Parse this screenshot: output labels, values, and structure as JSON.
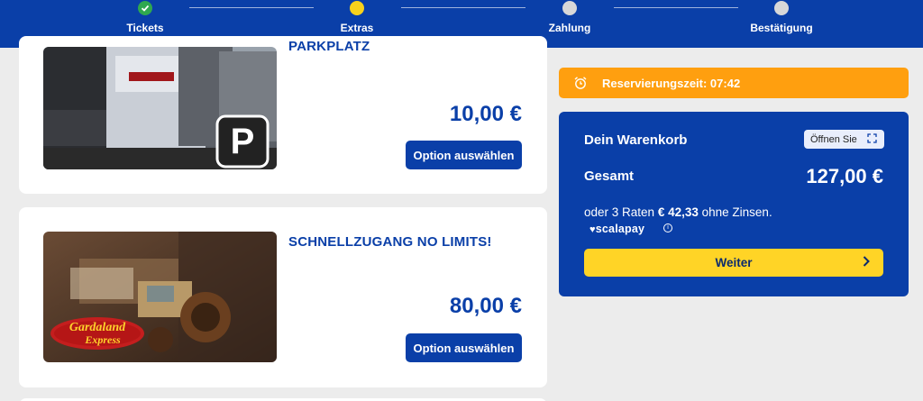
{
  "stepper": {
    "steps": [
      {
        "label": "Tickets",
        "state": "done"
      },
      {
        "label": "Extras",
        "state": "active"
      },
      {
        "label": "Zahlung",
        "state": "pending"
      },
      {
        "label": "Bestätigung",
        "state": "pending"
      }
    ]
  },
  "products": [
    {
      "title": "PARKPLATZ",
      "price": "10,00 €",
      "button": "Option auswählen",
      "image": "parking-lot-cars-photo"
    },
    {
      "title": "SCHNELLZUGANG NO LIMITS!",
      "price": "80,00 €",
      "button": "Option auswählen",
      "image": "gardaland-express-ride-photo",
      "logo_text": "Gardaland Express"
    }
  ],
  "timer": {
    "icon": "alarm-clock-icon",
    "text": "Reservierungszeit: 07:42"
  },
  "cart": {
    "title": "Dein Warenkorb",
    "open_label": "Öffnen Sie",
    "total_label": "Gesamt",
    "total_value": "127,00 €",
    "installment_prefix": "oder 3 Raten",
    "installment_amount": "€ 42,33",
    "installment_suffix": "ohne Zinsen.",
    "provider": "scalapay",
    "next_label": "Weiter"
  },
  "colors": {
    "primary": "#0a3fa8",
    "accent_yellow": "#ffd426",
    "timer_orange": "#ff9f0f",
    "done_green": "#2fa84f"
  }
}
